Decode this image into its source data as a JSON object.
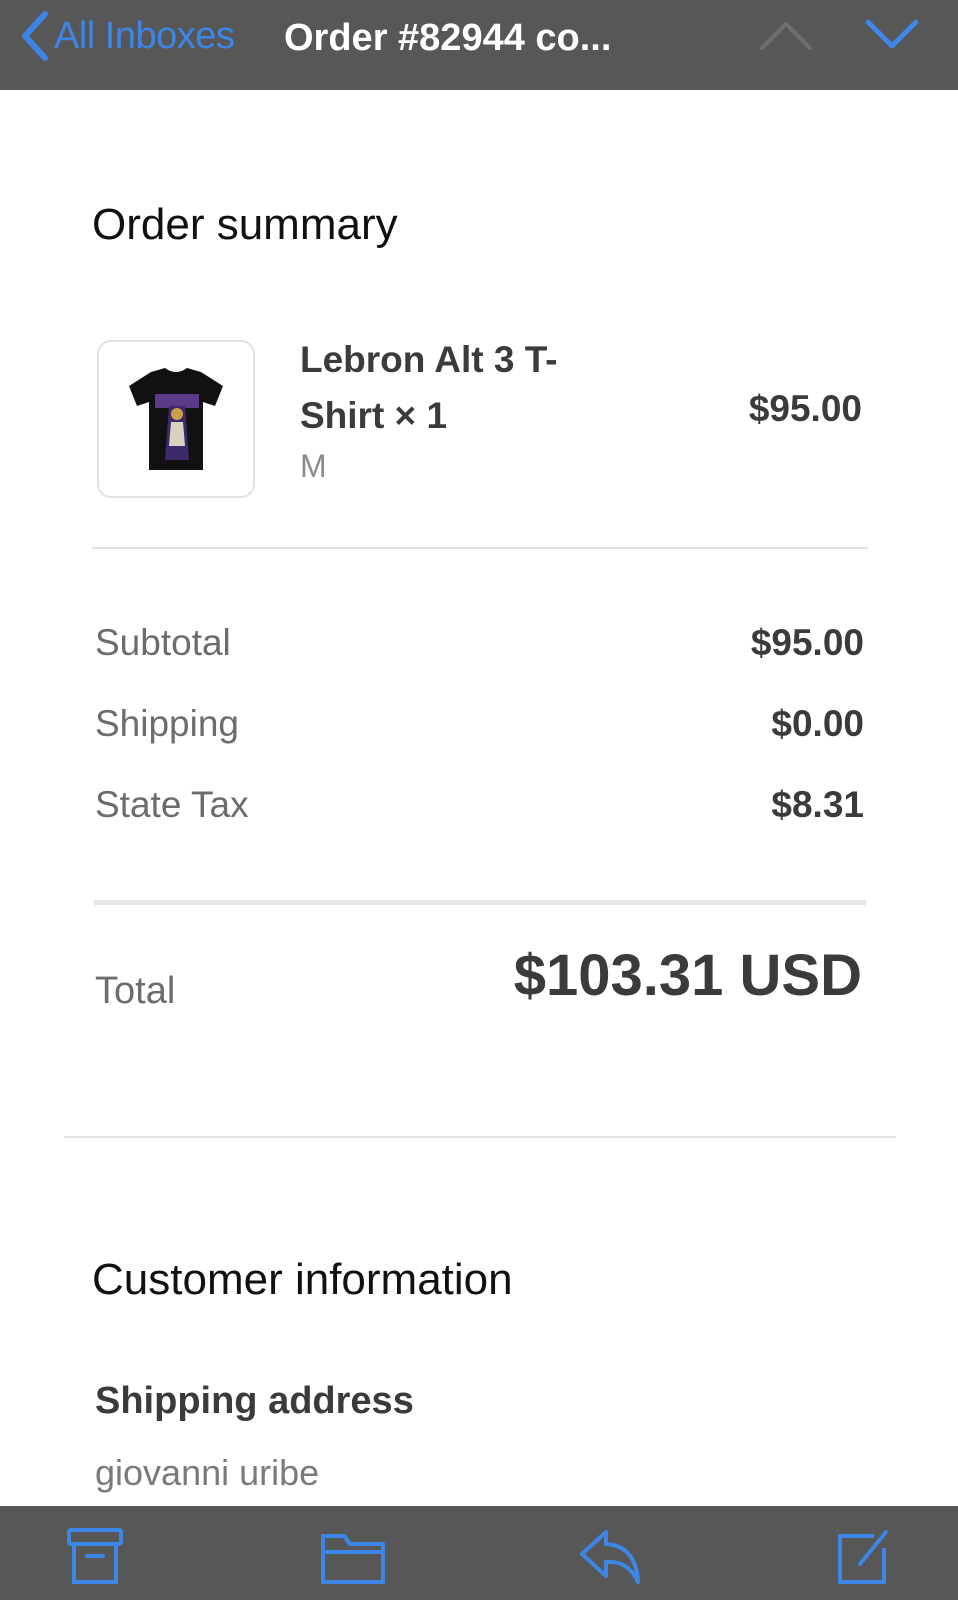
{
  "nav": {
    "back_label": "All Inboxes",
    "title": "Order #82944 co..."
  },
  "order_summary": {
    "title": "Order summary",
    "item": {
      "name": "Lebron Alt 3 T-Shirt × 1",
      "variant": "M",
      "price": "$95.00",
      "image_icon": "tshirt-image"
    },
    "lines": [
      {
        "label": "Subtotal",
        "value": "$95.00"
      },
      {
        "label": "Shipping",
        "value": "$0.00"
      },
      {
        "label": "State Tax",
        "value": "$8.31"
      }
    ],
    "total": {
      "label": "Total",
      "amount": "$103.31",
      "currency": "USD"
    }
  },
  "customer": {
    "title": "Customer information",
    "shipping_heading": "Shipping address",
    "name": "giovanni uribe"
  },
  "toolbar": {
    "icons": [
      "archive-icon",
      "folder-icon",
      "reply-icon",
      "compose-icon"
    ]
  },
  "colors": {
    "accent": "#3d86e6",
    "bar": "#575757",
    "text_dark": "#3b3b3b",
    "text_muted": "#6c6c6c"
  }
}
